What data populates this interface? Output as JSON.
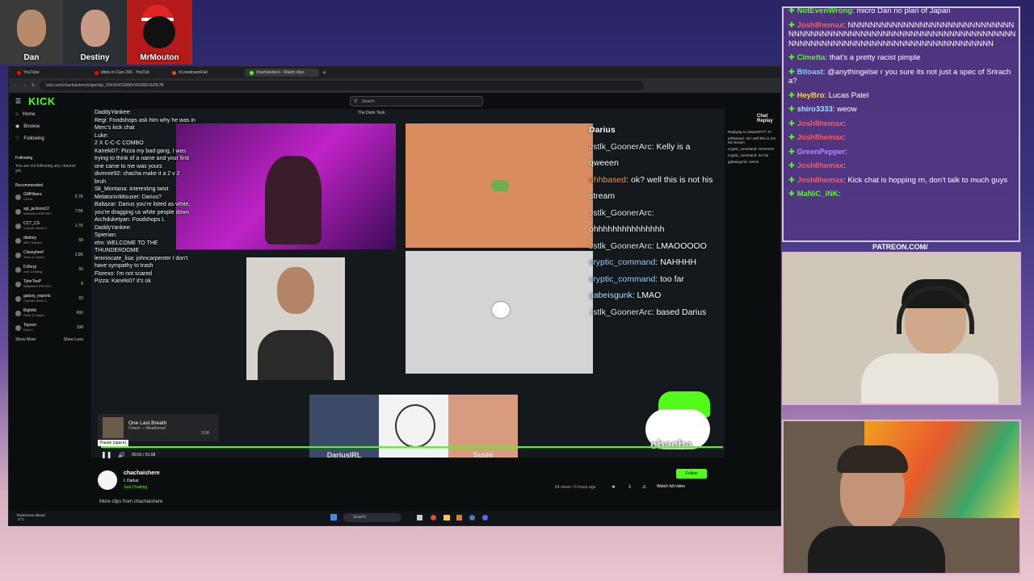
{
  "cams": [
    {
      "label": "Dan"
    },
    {
      "label": "Destiny"
    },
    {
      "label": "MrMouton"
    }
  ],
  "browser": {
    "tabs": [
      {
        "label": "YouTube",
        "color": "#ff0000"
      },
      {
        "label": "idiots in Cars 266 - YouTub",
        "color": "#ff0000"
      },
      {
        "label": "r/LivestreamFail",
        "color": "#ff4500"
      },
      {
        "label": "chachaishere - Watch clips",
        "color": "#53fc18"
      }
    ],
    "url": "kick.com/chachaishere/clips/clip_01K9X4C6956V4GN9EVEPE7B",
    "logo": "KICK",
    "search_placeholder": "Search"
  },
  "sidebar": {
    "nav": [
      {
        "label": "Home",
        "icon": "home-icon"
      },
      {
        "label": "Browse",
        "icon": "compass-icon"
      },
      {
        "label": "Following",
        "icon": "heart-icon"
      }
    ],
    "following_heading": "Following",
    "following_empty": "You are not following any channel yet.",
    "recommended_heading": "Recommended",
    "recommended": [
      {
        "name": "GMHikaru",
        "game": "Chess",
        "viewers": "5.7K"
      },
      {
        "name": "sgt_jackson12",
        "game": "Battlefield REDSEC",
        "viewers": "7.5K"
      },
      {
        "name": "CCT_CS",
        "game": "Counter-Strike 2",
        "viewers": "1.7K"
      },
      {
        "name": "dbiduty",
        "game": "ARC Raiders",
        "viewers": "58"
      },
      {
        "name": "Classybeef",
        "game": "Slots & Casino",
        "viewers": "2.8K"
      },
      {
        "name": "DJforgi",
        "game": "Just Chatting",
        "viewers": "55"
      },
      {
        "name": "TylerTeeP",
        "game": "Battlefield REDSEC",
        "viewers": "8"
      },
      {
        "name": "galaxy_esports",
        "game": "Counter-Strike 2",
        "viewers": "63"
      },
      {
        "name": "Bigfoltz",
        "game": "Slots & Casino",
        "viewers": "666"
      },
      {
        "name": "Topson",
        "game": "Dota 2",
        "viewers": "198"
      }
    ],
    "show_more": "Show More",
    "show_less": "Show Less"
  },
  "player": {
    "window_title": "The Dank Tank",
    "overlay_chat": [
      "DaddyYankee:",
      "Regi: Foodshops ask him why he was in",
      "Merc's kick chat",
      "Luke:",
      "2 X C-C-C COMBO",
      "Kaneki07: Pizza my bad gang, I was",
      "trying to think of a name and your first",
      "one came to me was yours",
      "divinnie92: chacha   make it a 2 v 2",
      "bruh",
      "Sk_Montana: interesting twist",
      "MelatoninMisuser:   Darius?",
      "Baltazar: Darius you're listed as white,",
      "you're dragging us white people down",
      "Archduketyan: Foodshops L",
      "DaddyYankee:",
      "Spierian:",
      "elm: WELCOME TO THE",
      "THUNDERDOME",
      "lemniscate_lisa: johncarpenter I don't",
      "have sympathy to trash",
      "Florexo:   I'm not scared",
      "Pizza: Kaneki07   it's ok"
    ],
    "big_chat_header": "Darius",
    "big_chat": [
      {
        "user": "Jstlk_GoonerArc",
        "text": ": Kelly is a qweeen",
        "color": "#e6e6e6"
      },
      {
        "user": "uhhbased",
        "text": ": ok? well this is not his stream",
        "color": "#ff9a3d"
      },
      {
        "user": "Jstlk_GoonerArc",
        "text": ": ohhhhhhhhhhhhhhh",
        "color": "#e6e6e6"
      },
      {
        "user": "Jstlk_GoonerArc",
        "text": ": LMAOOOOO",
        "color": "#e6e6e6"
      },
      {
        "user": "cryptic_command",
        "text": ": NAHHHH",
        "color": "#9fd6ff"
      },
      {
        "user": "cryptic_command",
        "text": ": too far",
        "color": "#9fd6ff"
      },
      {
        "user": "gabeisgunk",
        "text": ": LMAO",
        "color": "#bfe4ff"
      },
      {
        "user": "Jstlk_GoonerArc",
        "text": ": based Darius",
        "color": "#e6e6e6"
      }
    ],
    "strip": [
      {
        "label": "DariusIRL"
      },
      {
        "label": ""
      },
      {
        "label": "Sushi"
      }
    ],
    "mascot_text": "chacha",
    "music_title": "One Last Breath",
    "music_artist": "Creed — Weathered",
    "music_time": "3:58",
    "pause_tooltip": "Pause (space)",
    "time": "00:52 / 01:08",
    "chat_replay_label": "Chat Replay",
    "chat_replay_lines": [
      "Replying to Vasant0777: Fr",
      "uhhbased: ok? well this is not his stream",
      "cryptic_command: NAHHHH",
      "cryptic_command: too far",
      "gabeisgunk: LMAO"
    ]
  },
  "clip_info": {
    "channel": "chachaishere",
    "title": "L Darius",
    "category": "Just Chatting",
    "stats": "64 views • 5 hours ago",
    "follow_label": "Follow",
    "watch_full": "Watch full video",
    "more_clips": "More clips from chachaishere"
  },
  "taskbar": {
    "weather": "Rain/snow ahead",
    "temp": "-2°C",
    "search": "Search"
  },
  "stream_chat": [
    {
      "user": "NotEvenWrong",
      "text": ": micro Dan no plan of Japan",
      "color": "#53fc18"
    },
    {
      "user": "Josh8hemax",
      "text": ": NNNNNNNNNNNNNNNNNNNNNNNNNNNNNNNNNNNNNNNNNNNNNNNNNNNNNNNNNNNNNNNNNNNNNNNNNNNNNNNNNNNNNNNNNNNNNNNNNNNNNNNNNNNN",
      "color": "#ff5a5a"
    },
    {
      "user": "Cimetta",
      "text": ": that's a pretty racist pimple",
      "color": "#53fc18"
    },
    {
      "user": "Btloast",
      "text": ": @anythingelse r you sure its not just a spec of Sriracha?",
      "color": "#7fd0ff"
    },
    {
      "user": "HeyBro",
      "text": ": Lucas Patel",
      "color": "#ffd54a"
    },
    {
      "user": "shiro3333",
      "text": ": weow",
      "color": "#9fe3ff"
    },
    {
      "user": "Josh8hemax",
      "text": ":",
      "color": "#ff5a5a"
    },
    {
      "user": "Josh8hemax",
      "text": ":",
      "color": "#ff5a5a"
    },
    {
      "user": "GreenPepper",
      "text": ":",
      "color": "#b18cff"
    },
    {
      "user": "Josh8hemax",
      "text": ":",
      "color": "#ff5a5a"
    },
    {
      "user": "Josh8hemax",
      "text": ": Kick chat is hopping rn, don't talk to much guys",
      "color": "#ff5a5a"
    },
    {
      "user": "MaNiC_iNK",
      "text": ":",
      "color": "#53fc18"
    }
  ],
  "patreon": "PATREON.COM/",
  "colors": {
    "kick_green": "#53fc18",
    "accent_pink": "#e6b0d8"
  }
}
